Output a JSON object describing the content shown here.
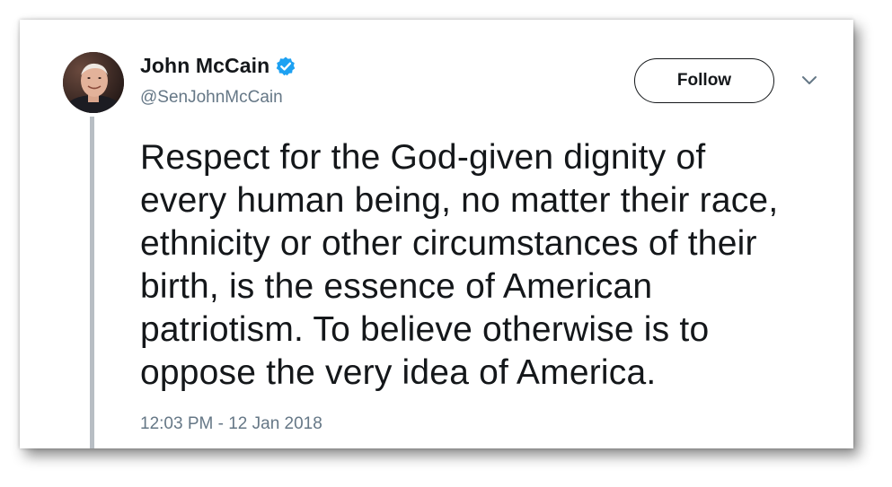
{
  "tweet": {
    "author": {
      "display_name": "John McCain",
      "handle": "@SenJohnMcCain",
      "verified": true
    },
    "follow_label": "Follow",
    "text": "Respect for the God-given dignity of\nevery human being, no matter their race,\nethnicity or other circumstances of their\nbirth, is the essence of American\npatriotism. To believe otherwise is to\noppose the very idea of America.",
    "timestamp": "12:03 PM - 12 Jan 2018"
  },
  "icons": {
    "verified": "verified-badge-icon",
    "caret": "chevron-down-icon"
  },
  "colors": {
    "text_primary": "#14171a",
    "text_secondary": "#657786",
    "verified_blue": "#1da1f2",
    "thread_line": "#b8bec4"
  }
}
